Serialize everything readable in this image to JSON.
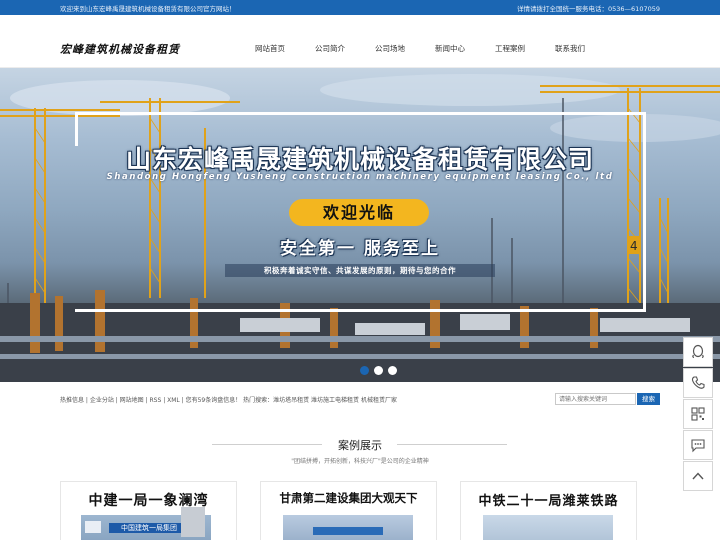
{
  "topbar": {
    "welcome": "欢迎来到山东宏峰禹晟建筑机械设备租赁有限公司官方网站！",
    "hotline": "详情请拨打全国统一服务电话：0536—6107059"
  },
  "header": {
    "logo_text": "宏峰建筑机械设备租赁",
    "nav": [
      "网站首页",
      "公司简介",
      "公司场地",
      "新闻中心",
      "工程案例",
      "联系我们"
    ]
  },
  "banner": {
    "title": "山东宏峰禹晟建筑机械设备租赁有限公司",
    "subtitle_en": "Shandong Hongfeng Yusheng construction machinery equipment leasing Co., ltd",
    "welcome": "欢迎光临",
    "slogan": "安全第一  服务至上",
    "tagline": "积极奔着诚实守信、共谋发展的原则，期待与您的合作",
    "crane_number": "4",
    "slide_count": 3,
    "active_slide": 1
  },
  "infobar": {
    "text": "热推信息 | 企业分站 | 网站地图 | RSS | XML | 您有59条询盘信息！ 热门搜索：潍坊塔吊租赁 潍坊施工电梯租赁 机械租赁厂家"
  },
  "search": {
    "placeholder": "请输入搜索关键词",
    "button": "搜索"
  },
  "cases": {
    "title": "案例展示",
    "subtitle": "\"团结拼搏，开拓创新，科技兴厂\"是公司的企业精神",
    "items": [
      {
        "title": "中建一局一象澜湾"
      },
      {
        "title": "甘肃第二建设集团大观天下"
      },
      {
        "title": "中铁二十一局潍莱铁路"
      }
    ],
    "image_sign_text": "中国建筑一局集团"
  },
  "float_buttons": [
    "qq-icon",
    "phone-icon",
    "qrcode-icon",
    "message-icon",
    "back-to-top-icon"
  ],
  "colors": {
    "brand_blue": "#1b66b3",
    "welcome_yellow": "#f3b61f"
  }
}
